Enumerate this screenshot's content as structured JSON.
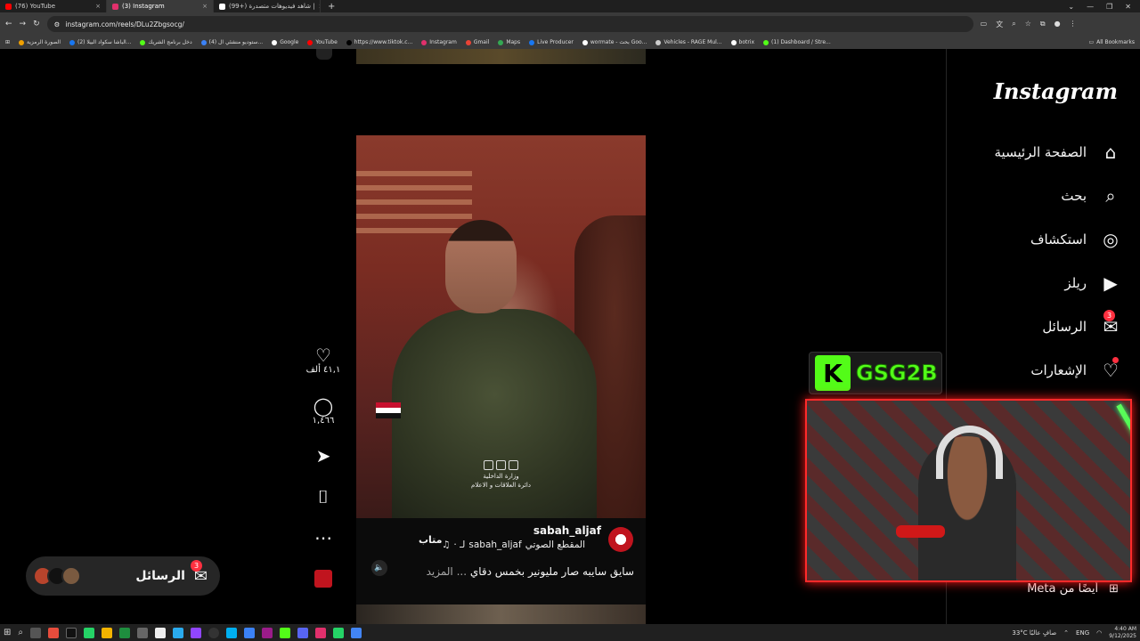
{
  "browser": {
    "tabs": [
      {
        "title": "(76) YouTube",
        "color": "#ff0000",
        "active": false
      },
      {
        "title": "(3) Instagram",
        "color": "#e1306c",
        "active": true
      },
      {
        "title": "(99+) شاهد فيديوهات متصدرة |",
        "color": "#ffffff",
        "active": false
      }
    ],
    "url": "instagram.com/reels/DLu2Zbgsocg/",
    "bookmarks": [
      {
        "label": "الصورة الرمزية",
        "color": "#f0a000"
      },
      {
        "label": "(2) الباشا سكواد البيلا...",
        "color": "#1877f2"
      },
      {
        "label": "دخل برنامج الشريك",
        "color": "#53fc18"
      },
      {
        "label": "(4) ستوديو منشئي ال...",
        "color": "#3b82f6"
      },
      {
        "label": "Google",
        "color": "#ffffff"
      },
      {
        "label": "YouTube",
        "color": "#ff0000"
      },
      {
        "label": "https://www.tiktok.c...",
        "color": "#000000"
      },
      {
        "label": "Instagram",
        "color": "#e1306c"
      },
      {
        "label": "Gmail",
        "color": "#ea4335"
      },
      {
        "label": "Maps",
        "color": "#34a853"
      },
      {
        "label": "Live Producer",
        "color": "#1877f2"
      },
      {
        "label": "wormate - بحث Goo...",
        "color": "#ffffff"
      },
      {
        "label": "Vehicles - RAGE Mul...",
        "color": "#cccccc"
      },
      {
        "label": "botrix",
        "color": "#ffffff"
      },
      {
        "label": "(1) Dashboard / Stre...",
        "color": "#53fc18"
      }
    ],
    "all_bookmarks": "All Bookmarks"
  },
  "instagram": {
    "logo": "Instagram",
    "nav": [
      {
        "label": "الصفحة الرئيسية",
        "icon": "home-icon",
        "glyph": "⌂"
      },
      {
        "label": "بحث",
        "icon": "search-icon",
        "glyph": "⌕"
      },
      {
        "label": "استكشاف",
        "icon": "compass-icon",
        "glyph": "◎"
      },
      {
        "label": "ريلز",
        "icon": "reels-icon",
        "glyph": "▶"
      },
      {
        "label": "الرسائل",
        "icon": "messenger-icon",
        "glyph": "✉",
        "badge": "3"
      },
      {
        "label": "الإشعارات",
        "icon": "heart-icon",
        "glyph": "♡",
        "dot": true
      }
    ],
    "meta_link": "أيضًا من Meta",
    "reel": {
      "username": "sabah_aljaf",
      "follow": "متاب",
      "audio_user": "sabah_aljaf",
      "audio_sep": "لـ ·",
      "audio_label": "المقطع الصوتي",
      "caption": "سايق سايبه صار مليونير بخمس دقاي",
      "more": "... المزيد",
      "watermark_line1": "وزارة الداخلية",
      "watermark_line2": "دائرة العلاقات و الاعلام"
    },
    "actions": {
      "likes": "٤١,١ ألف",
      "comments": "١,٤٦٦"
    },
    "messages_pill": {
      "label": "الرسائل",
      "badge": "3"
    }
  },
  "overlay": {
    "kick_letter": "K",
    "kick_name": "GSG2B"
  },
  "taskbar": {
    "weather": "33°C صافٍ عالبًا",
    "lang": "ENG",
    "time": "4:40 AM",
    "date": "9/12/2025"
  },
  "colors": {
    "accent": "#ff3040",
    "kick": "#53fc18"
  }
}
